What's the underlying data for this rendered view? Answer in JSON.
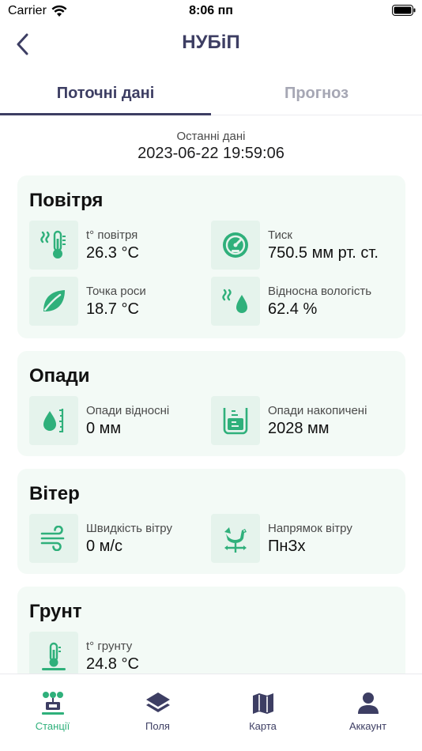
{
  "status_bar": {
    "carrier": "Carrier",
    "time": "8:06 пп"
  },
  "nav": {
    "title": "НУБіП"
  },
  "tabs": [
    {
      "label": "Поточні дані",
      "active": true
    },
    {
      "label": "Прогноз",
      "active": false
    }
  ],
  "last_data": {
    "label": "Останні дані",
    "value": "2023-06-22 19:59:06"
  },
  "sections": {
    "air": {
      "title": "Повітря",
      "metrics": [
        {
          "label": "t° повітря",
          "value": "26.3 °C",
          "icon": "heat-thermometer-icon"
        },
        {
          "label": "Тиск",
          "value": "750.5 мм рт. ст.",
          "icon": "gauge-icon"
        },
        {
          "label": "Точка роси",
          "value": "18.7 °C",
          "icon": "leaf-icon"
        },
        {
          "label": "Відносна вологість",
          "value": "62.4 %",
          "icon": "humidity-drop-icon"
        }
      ]
    },
    "precipitation": {
      "title": "Опади",
      "metrics": [
        {
          "label": "Опади відносні",
          "value": "0 мм",
          "icon": "drop-ruler-icon"
        },
        {
          "label": "Опади накопичені",
          "value": "2028 мм",
          "icon": "rain-gauge-icon"
        }
      ]
    },
    "wind": {
      "title": "Вітер",
      "metrics": [
        {
          "label": "Швидкість вітру",
          "value": "0 м/с",
          "icon": "wind-icon"
        },
        {
          "label": "Напрямок вітру",
          "value": "ПнЗх",
          "icon": "weathervane-rooster-icon"
        }
      ]
    },
    "soil": {
      "title": "Грунт",
      "metrics": [
        {
          "label": "t° грунту",
          "value": "24.8 °C",
          "icon": "soil-thermometer-icon"
        }
      ]
    }
  },
  "tab_bar": [
    {
      "label": "Станції",
      "icon": "stations-icon",
      "active": true
    },
    {
      "label": "Поля",
      "icon": "layers-icon",
      "active": false
    },
    {
      "label": "Карта",
      "icon": "map-icon",
      "active": false
    },
    {
      "label": "Аккаунт",
      "icon": "account-icon",
      "active": false
    }
  ],
  "colors": {
    "accent": "#2fb07b",
    "title": "#3d3e63",
    "card_bg": "#f3faf6",
    "icon_bg": "#e5f3ec",
    "inactive_tab": "#a6a7b4"
  }
}
